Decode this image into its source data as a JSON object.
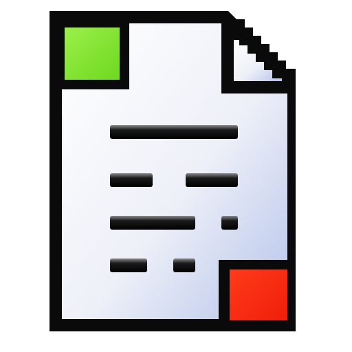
{
  "icon": {
    "name": "document-with-status-markers",
    "colors": {
      "page_top": "#ffffff",
      "page_bottom": "#b4c3ea",
      "outline": "#0a0a0a",
      "start_marker": "#7fe82e",
      "end_marker": "#ff2a10",
      "text_lines": "#1a1a1a"
    }
  }
}
